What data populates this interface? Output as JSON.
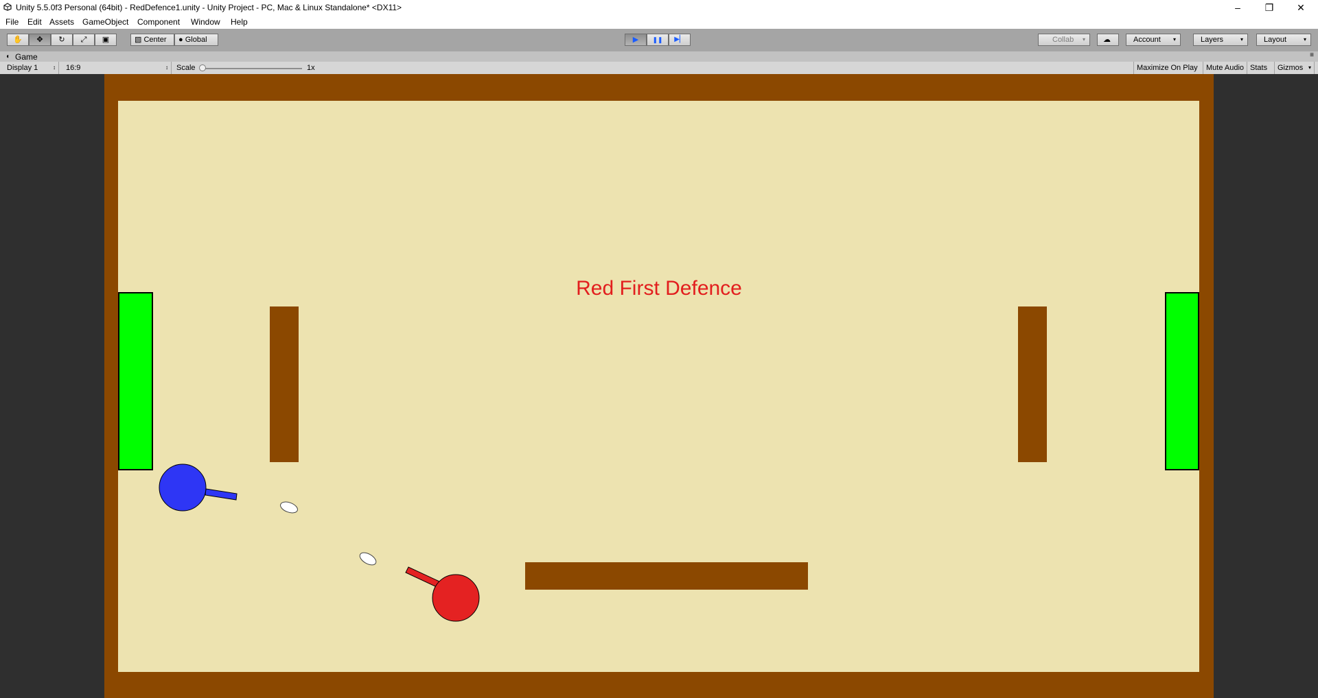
{
  "window": {
    "title": "Unity 5.5.0f3 Personal (64bit) - RedDefence1.unity - Unity Project - PC, Mac & Linux Standalone* <DX11>",
    "minimize_glyph": "–",
    "restore_glyph": "❐",
    "close_glyph": "✕"
  },
  "menu": [
    "File",
    "Edit",
    "Assets",
    "GameObject",
    "Component",
    "Window",
    "Help"
  ],
  "toolbar": {
    "tools": [
      {
        "icon": "hand-tool-icon",
        "glyph": "✋"
      },
      {
        "icon": "move-tool-icon",
        "glyph": "✥"
      },
      {
        "icon": "rotate-tool-icon",
        "glyph": "↻"
      },
      {
        "icon": "scale-tool-icon",
        "glyph": "⤢"
      },
      {
        "icon": "rect-tool-icon",
        "glyph": "▣"
      }
    ],
    "pivot_label": "Center",
    "space_label": "Global",
    "play_glyph": "▶",
    "pause_glyph": "❚❚",
    "step_glyph": "▶▏",
    "collab_label": "Collab",
    "cloud_glyph": "☁",
    "account_label": "Account",
    "layers_label": "Layers",
    "layout_label": "Layout",
    "dropdown_arrow": "▾"
  },
  "game_tab": {
    "icon_glyph": "◖",
    "label": "Game",
    "menu_glyph": "≡"
  },
  "game_toolbar": {
    "display": "Display 1",
    "aspect": "16:9",
    "scale_label": "Scale",
    "scale_value": "1x",
    "maximize_on_play": "Maximize On Play",
    "mute_audio": "Mute Audio",
    "stats": "Stats",
    "gizmos": "Gizmos",
    "selector_arrow": "↕",
    "dropdown_arrow": "▾"
  },
  "game": {
    "headline": "Red First Defence",
    "colors": {
      "wall": "#8b4800",
      "floor": "#ede3b0",
      "goal": "#00ff00",
      "blue_tank": "#2e36f5",
      "red_tank": "#e42222",
      "bullet": "#ffffff",
      "headline": "#e21e1e"
    }
  }
}
